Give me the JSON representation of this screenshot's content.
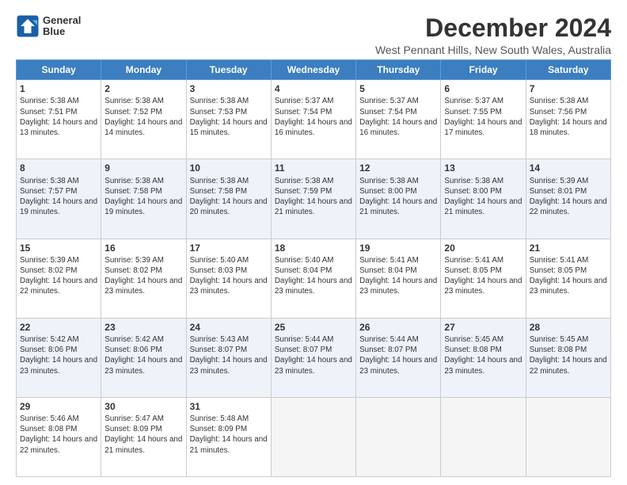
{
  "logo": {
    "line1": "General",
    "line2": "Blue"
  },
  "title": "December 2024",
  "subtitle": "West Pennant Hills, New South Wales, Australia",
  "headers": [
    "Sunday",
    "Monday",
    "Tuesday",
    "Wednesday",
    "Thursday",
    "Friday",
    "Saturday"
  ],
  "rows": [
    {
      "shaded": false,
      "cells": [
        {
          "day": "1",
          "rise": "Sunrise: 5:38 AM",
          "set": "Sunset: 7:51 PM",
          "daylight": "Daylight: 14 hours and 13 minutes."
        },
        {
          "day": "2",
          "rise": "Sunrise: 5:38 AM",
          "set": "Sunset: 7:52 PM",
          "daylight": "Daylight: 14 hours and 14 minutes."
        },
        {
          "day": "3",
          "rise": "Sunrise: 5:38 AM",
          "set": "Sunset: 7:53 PM",
          "daylight": "Daylight: 14 hours and 15 minutes."
        },
        {
          "day": "4",
          "rise": "Sunrise: 5:37 AM",
          "set": "Sunset: 7:54 PM",
          "daylight": "Daylight: 14 hours and 16 minutes."
        },
        {
          "day": "5",
          "rise": "Sunrise: 5:37 AM",
          "set": "Sunset: 7:54 PM",
          "daylight": "Daylight: 14 hours and 16 minutes."
        },
        {
          "day": "6",
          "rise": "Sunrise: 5:37 AM",
          "set": "Sunset: 7:55 PM",
          "daylight": "Daylight: 14 hours and 17 minutes."
        },
        {
          "day": "7",
          "rise": "Sunrise: 5:38 AM",
          "set": "Sunset: 7:56 PM",
          "daylight": "Daylight: 14 hours and 18 minutes."
        }
      ]
    },
    {
      "shaded": true,
      "cells": [
        {
          "day": "8",
          "rise": "Sunrise: 5:38 AM",
          "set": "Sunset: 7:57 PM",
          "daylight": "Daylight: 14 hours and 19 minutes."
        },
        {
          "day": "9",
          "rise": "Sunrise: 5:38 AM",
          "set": "Sunset: 7:58 PM",
          "daylight": "Daylight: 14 hours and 19 minutes."
        },
        {
          "day": "10",
          "rise": "Sunrise: 5:38 AM",
          "set": "Sunset: 7:58 PM",
          "daylight": "Daylight: 14 hours and 20 minutes."
        },
        {
          "day": "11",
          "rise": "Sunrise: 5:38 AM",
          "set": "Sunset: 7:59 PM",
          "daylight": "Daylight: 14 hours and 21 minutes."
        },
        {
          "day": "12",
          "rise": "Sunrise: 5:38 AM",
          "set": "Sunset: 8:00 PM",
          "daylight": "Daylight: 14 hours and 21 minutes."
        },
        {
          "day": "13",
          "rise": "Sunrise: 5:38 AM",
          "set": "Sunset: 8:00 PM",
          "daylight": "Daylight: 14 hours and 21 minutes."
        },
        {
          "day": "14",
          "rise": "Sunrise: 5:39 AM",
          "set": "Sunset: 8:01 PM",
          "daylight": "Daylight: 14 hours and 22 minutes."
        }
      ]
    },
    {
      "shaded": false,
      "cells": [
        {
          "day": "15",
          "rise": "Sunrise: 5:39 AM",
          "set": "Sunset: 8:02 PM",
          "daylight": "Daylight: 14 hours and 22 minutes."
        },
        {
          "day": "16",
          "rise": "Sunrise: 5:39 AM",
          "set": "Sunset: 8:02 PM",
          "daylight": "Daylight: 14 hours and 23 minutes."
        },
        {
          "day": "17",
          "rise": "Sunrise: 5:40 AM",
          "set": "Sunset: 8:03 PM",
          "daylight": "Daylight: 14 hours and 23 minutes."
        },
        {
          "day": "18",
          "rise": "Sunrise: 5:40 AM",
          "set": "Sunset: 8:04 PM",
          "daylight": "Daylight: 14 hours and 23 minutes."
        },
        {
          "day": "19",
          "rise": "Sunrise: 5:41 AM",
          "set": "Sunset: 8:04 PM",
          "daylight": "Daylight: 14 hours and 23 minutes."
        },
        {
          "day": "20",
          "rise": "Sunrise: 5:41 AM",
          "set": "Sunset: 8:05 PM",
          "daylight": "Daylight: 14 hours and 23 minutes."
        },
        {
          "day": "21",
          "rise": "Sunrise: 5:41 AM",
          "set": "Sunset: 8:05 PM",
          "daylight": "Daylight: 14 hours and 23 minutes."
        }
      ]
    },
    {
      "shaded": true,
      "cells": [
        {
          "day": "22",
          "rise": "Sunrise: 5:42 AM",
          "set": "Sunset: 8:06 PM",
          "daylight": "Daylight: 14 hours and 23 minutes."
        },
        {
          "day": "23",
          "rise": "Sunrise: 5:42 AM",
          "set": "Sunset: 8:06 PM",
          "daylight": "Daylight: 14 hours and 23 minutes."
        },
        {
          "day": "24",
          "rise": "Sunrise: 5:43 AM",
          "set": "Sunset: 8:07 PM",
          "daylight": "Daylight: 14 hours and 23 minutes."
        },
        {
          "day": "25",
          "rise": "Sunrise: 5:44 AM",
          "set": "Sunset: 8:07 PM",
          "daylight": "Daylight: 14 hours and 23 minutes."
        },
        {
          "day": "26",
          "rise": "Sunrise: 5:44 AM",
          "set": "Sunset: 8:07 PM",
          "daylight": "Daylight: 14 hours and 23 minutes."
        },
        {
          "day": "27",
          "rise": "Sunrise: 5:45 AM",
          "set": "Sunset: 8:08 PM",
          "daylight": "Daylight: 14 hours and 23 minutes."
        },
        {
          "day": "28",
          "rise": "Sunrise: 5:45 AM",
          "set": "Sunset: 8:08 PM",
          "daylight": "Daylight: 14 hours and 22 minutes."
        }
      ]
    },
    {
      "shaded": false,
      "cells": [
        {
          "day": "29",
          "rise": "Sunrise: 5:46 AM",
          "set": "Sunset: 8:08 PM",
          "daylight": "Daylight: 14 hours and 22 minutes."
        },
        {
          "day": "30",
          "rise": "Sunrise: 5:47 AM",
          "set": "Sunset: 8:09 PM",
          "daylight": "Daylight: 14 hours and 21 minutes."
        },
        {
          "day": "31",
          "rise": "Sunrise: 5:48 AM",
          "set": "Sunset: 8:09 PM",
          "daylight": "Daylight: 14 hours and 21 minutes."
        },
        null,
        null,
        null,
        null
      ]
    }
  ]
}
